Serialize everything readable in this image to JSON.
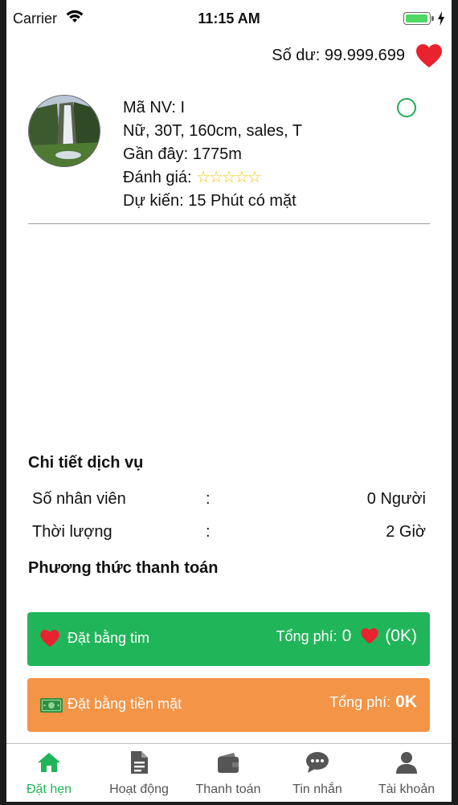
{
  "status_bar": {
    "carrier": "Carrier",
    "time": "11:15 AM",
    "battery_percent": 100
  },
  "balance": {
    "text": "Số dư: 99.999.699"
  },
  "profile": {
    "employee_id": "Mã NV: I",
    "details": "Nữ, 30T, 160cm, sales, T",
    "distance": "Gần đây: 1775m",
    "rating_label": "Đánh giá:",
    "rating_stars": "☆☆☆☆☆",
    "rating_value": 0,
    "eta": "Dự kiến: 15 Phút có mặt"
  },
  "service": {
    "title": "Chi tiết dịch vụ",
    "rows": [
      {
        "label": "Số nhân viên",
        "colon": ":",
        "value": "0 Người"
      },
      {
        "label": "Thời lượng",
        "colon": ":",
        "value": "2 Giờ"
      }
    ]
  },
  "payment": {
    "title": "Phương thức thanh toán",
    "heart_option": {
      "label": "Đặt bằng tim",
      "total_label": "Tổng phí:",
      "amount": "0",
      "suffix": "(0K)"
    },
    "cash_option": {
      "label": "Đặt bằng tiền mặt",
      "total_label": "Tổng phí:",
      "amount": "0K"
    }
  },
  "tabs": [
    {
      "label": "Đặt hẹn",
      "icon": "home-icon",
      "active": true
    },
    {
      "label": "Hoạt động",
      "icon": "document-icon",
      "active": false
    },
    {
      "label": "Thanh toán",
      "icon": "wallet-icon",
      "active": false
    },
    {
      "label": "Tin nhắn",
      "icon": "chat-icon",
      "active": false
    },
    {
      "label": "Tài khoản",
      "icon": "person-icon",
      "active": false
    }
  ],
  "colors": {
    "accent_green": "#21b559",
    "cash_orange": "#f39446",
    "heart_red": "#e8222e",
    "star_yellow": "#f2c200",
    "battery_green": "#4cd964"
  }
}
